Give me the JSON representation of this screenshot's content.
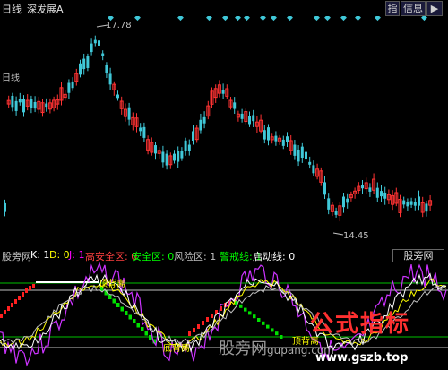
{
  "header": {
    "period": "日线",
    "stock_name": "深发展A",
    "btn_index": "指",
    "btn_info": "信息",
    "btn_expand": "▶"
  },
  "main_chart": {
    "high_label": "17.78",
    "low_label": "14.45",
    "period_label": "日线",
    "markers": "◆"
  },
  "indicator": {
    "name": "股旁网",
    "items": [
      {
        "text": "股旁网",
        "color": "#c0c0c0"
      },
      {
        "text": "K: 1",
        "color": "#ffffff"
      },
      {
        "text": "D: 0",
        "color": "#ffff00"
      },
      {
        "text": "J: 1",
        "color": "#ff00ff"
      },
      {
        "text": "高安全区: 0",
        "color": "#ff4040"
      },
      {
        "text": "安全区: 0",
        "color": "#00ff00"
      },
      {
        "text": "风险区: 1",
        "color": "#c0c0c0"
      },
      {
        "text": "警戒线: 1",
        "color": "#00ff00"
      },
      {
        "text": "启动线: 0",
        "color": "#ffffff"
      }
    ],
    "label_top": "顶背离",
    "label_bottom": "底背离",
    "label_mid": "顶背离"
  },
  "watermark": {
    "site_cn": "股旁网",
    "formula": "公式指标",
    "url_partial": "gupang.com",
    "url": "www.gszb.top"
  },
  "colors": {
    "up": "#ff3333",
    "down": "#40c8d8",
    "bg": "#000000",
    "markers": "#40c8d8"
  }
}
